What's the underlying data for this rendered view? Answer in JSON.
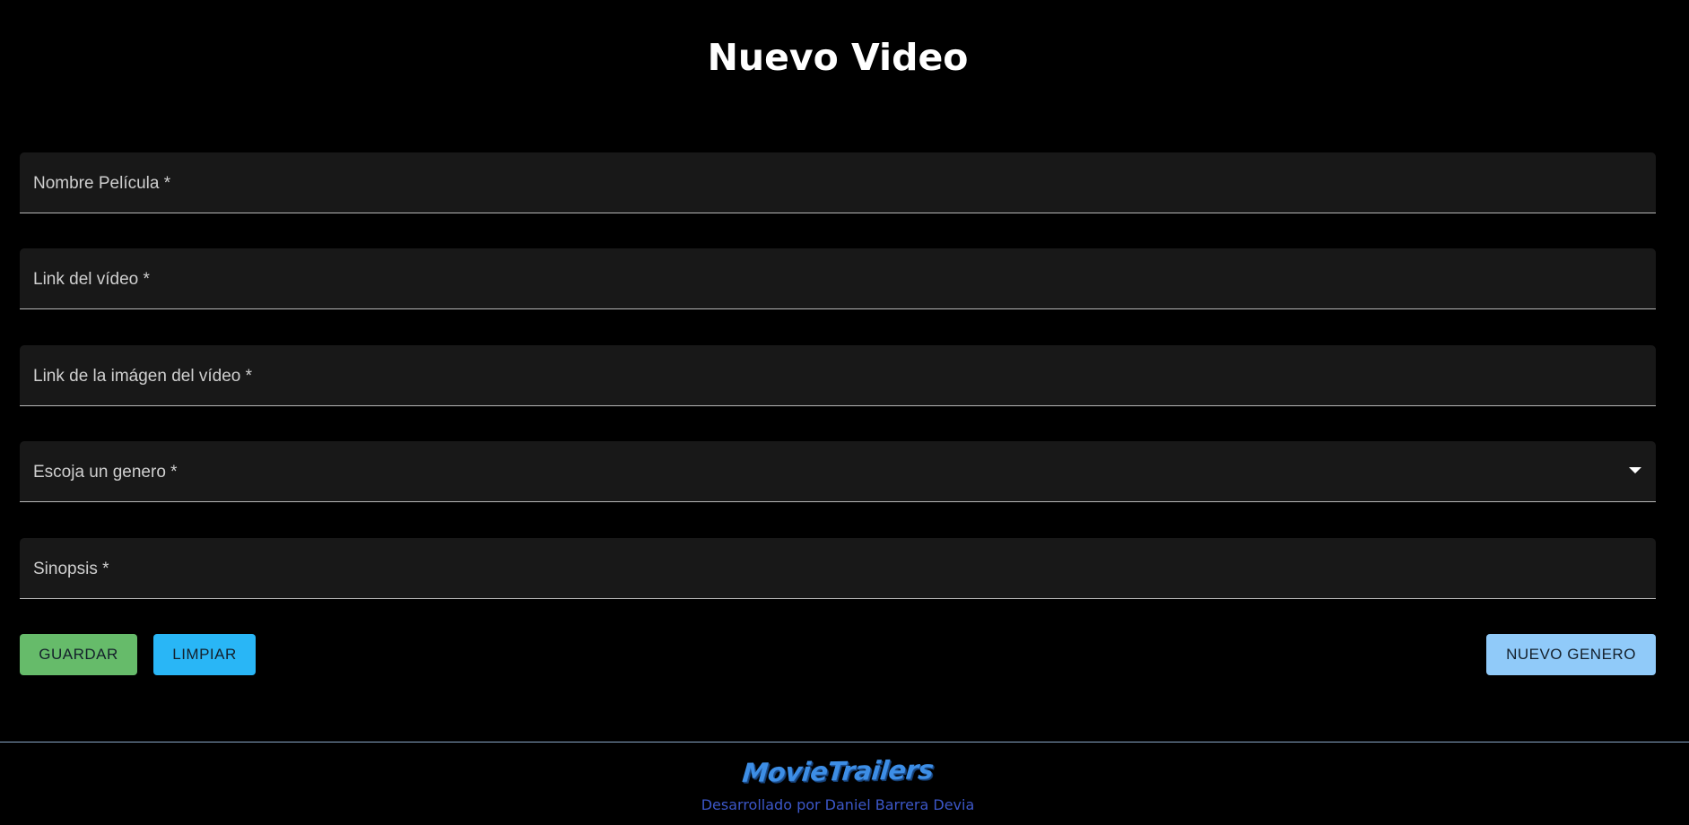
{
  "page": {
    "title": "Nuevo Video"
  },
  "form": {
    "fields": [
      {
        "label": "Nombre Película *"
      },
      {
        "label": "Link del vídeo *"
      },
      {
        "label": "Link de la imágen del vídeo *"
      },
      {
        "label": "Escoja un genero *"
      },
      {
        "label": "Sinopsis *"
      }
    ]
  },
  "actions": {
    "save_label": "GUARDAR",
    "clear_label": "LIMPIAR",
    "new_genre_label": "NUEVO GENERO"
  },
  "colors": {
    "save": "#66bb6a",
    "clear": "#29b6f6",
    "new_genre": "#90caf9"
  },
  "footer": {
    "brand": "MovieTrailers",
    "credit": "Desarrollado por Daniel Barrera Devia"
  }
}
